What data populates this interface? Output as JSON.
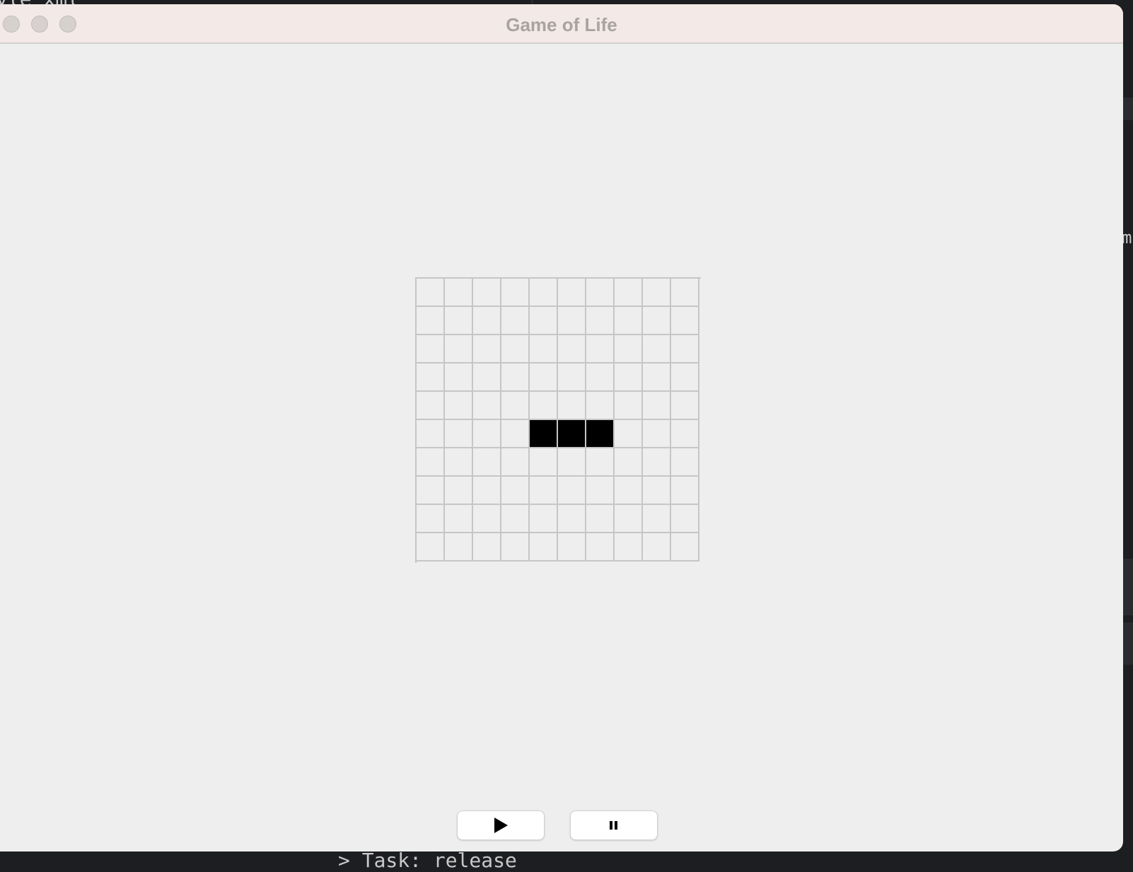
{
  "window": {
    "title": "Game of Life",
    "controls": [
      "close",
      "minimize",
      "zoom"
    ]
  },
  "background": {
    "top_text": "yle xml",
    "right_text": "m",
    "bottom_text": "> Task: release"
  },
  "board": {
    "rows": 10,
    "cols": 10,
    "alive_cells": [
      [
        5,
        4
      ],
      [
        5,
        5
      ],
      [
        5,
        6
      ]
    ],
    "alive_color": "#000000",
    "dead_color": "#eeeeee",
    "grid_color": "#c6c6c6"
  },
  "toolbar": {
    "play_icon": "play-icon",
    "pause_icon": "pause-icon"
  }
}
